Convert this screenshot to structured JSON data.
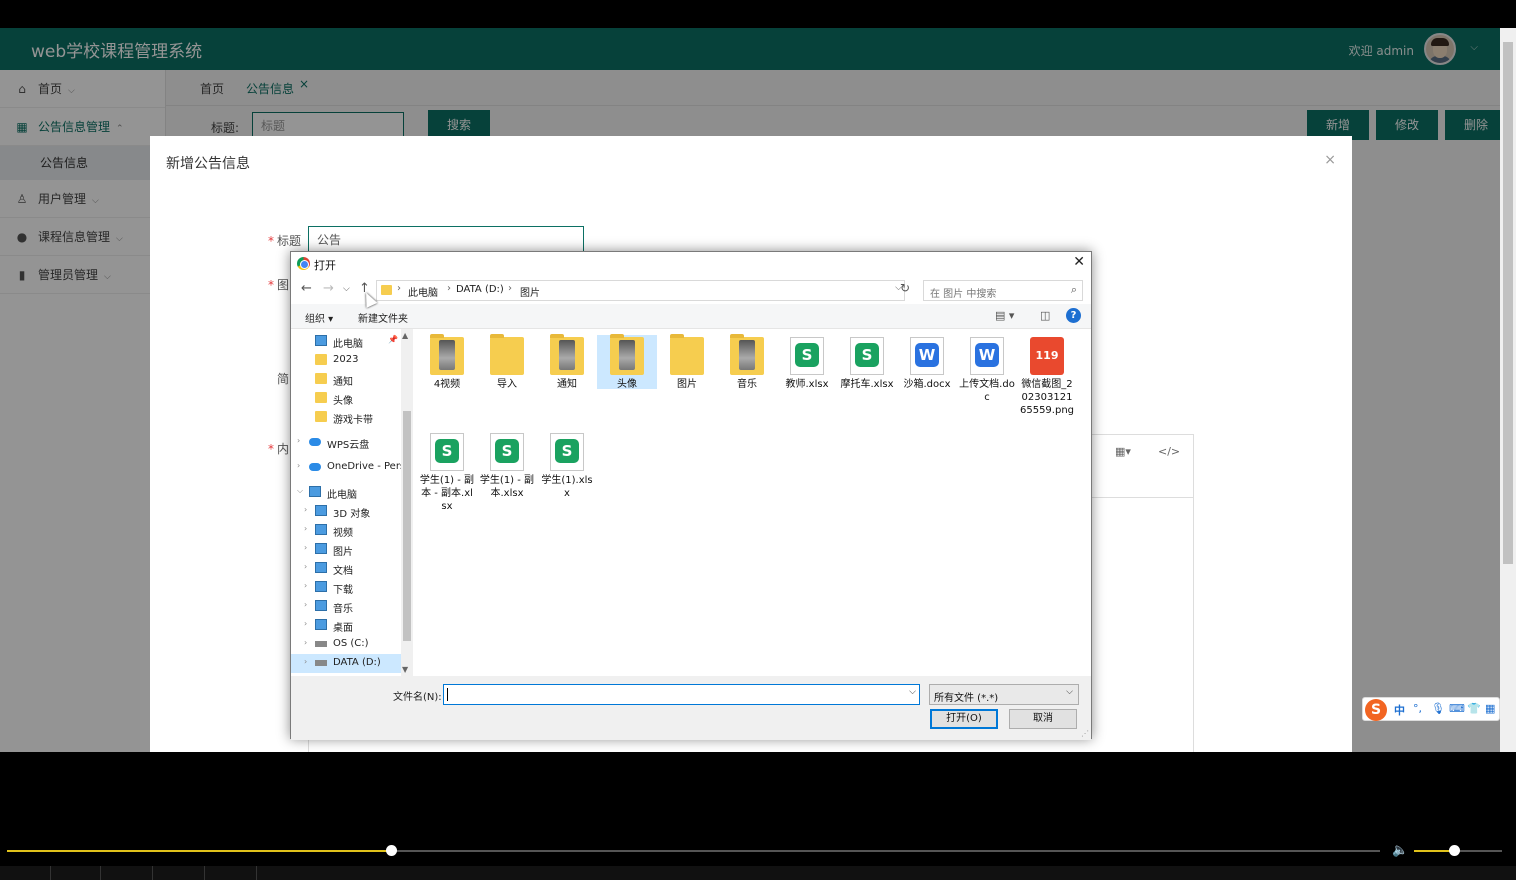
{
  "app": {
    "title": "web学校课程管理系统",
    "welcome": "欢迎 admin",
    "brand_color": "#0c7064"
  },
  "sidebar": {
    "items": [
      {
        "label": "首页",
        "icon": "home-icon"
      },
      {
        "label": "公告信息管理",
        "icon": "grid-icon"
      },
      {
        "label": "用户管理",
        "icon": "user-icon"
      },
      {
        "label": "课程信息管理",
        "icon": "book-icon"
      },
      {
        "label": "管理员管理",
        "icon": "admin-icon"
      }
    ],
    "sub_item": "公告信息"
  },
  "tabs": [
    {
      "label": "首页"
    },
    {
      "label": "公告信息"
    }
  ],
  "toolbar": {
    "search_label": "标题:",
    "search_placeholder": "标题",
    "search_button": "搜索",
    "add_button": "新增",
    "edit_button": "修改",
    "delete_button": "删除"
  },
  "modal": {
    "title": "新增公告信息",
    "close": "×",
    "fields": {
      "title_label": "标题",
      "title_value": "公告",
      "image_label": "图",
      "summary_label": "简",
      "content_label": "内"
    },
    "editor_table_icon": "▦▾",
    "editor_code_icon": "</>"
  },
  "dialog": {
    "title": "打开",
    "breadcrumb": [
      "此电脑",
      "DATA (D:)",
      "图片"
    ],
    "search_placeholder": "在 图片 中搜索",
    "commands": {
      "organize": "组织 ▾",
      "new_folder": "新建文件夹"
    },
    "tree": [
      {
        "label": "此电脑",
        "type": "pc",
        "pinned": true
      },
      {
        "label": "2023",
        "type": "folder"
      },
      {
        "label": "通知",
        "type": "folder"
      },
      {
        "label": "头像",
        "type": "folder"
      },
      {
        "label": "游戏卡带",
        "type": "folder"
      },
      {
        "label": "WPS云盘",
        "type": "cloud"
      },
      {
        "label": "OneDrive - Perso",
        "type": "cloud"
      },
      {
        "label": "此电脑",
        "type": "pc"
      },
      {
        "label": "3D 对象",
        "type": "pc"
      },
      {
        "label": "视频",
        "type": "pc"
      },
      {
        "label": "图片",
        "type": "pc"
      },
      {
        "label": "文档",
        "type": "pc"
      },
      {
        "label": "下载",
        "type": "pc"
      },
      {
        "label": "音乐",
        "type": "pc"
      },
      {
        "label": "桌面",
        "type": "pc"
      },
      {
        "label": "OS (C:)",
        "type": "drive"
      },
      {
        "label": "DATA (D:)",
        "type": "drive",
        "selected": true
      }
    ],
    "files": [
      {
        "name": "4视频",
        "type": "folder-photo"
      },
      {
        "name": "导入",
        "type": "folder"
      },
      {
        "name": "通知",
        "type": "folder-photo"
      },
      {
        "name": "头像",
        "type": "folder-photo",
        "selected": true
      },
      {
        "name": "图片",
        "type": "folder"
      },
      {
        "name": "音乐",
        "type": "folder-photo"
      },
      {
        "name": "教师.xlsx",
        "type": "sheet"
      },
      {
        "name": "摩托车.xlsx",
        "type": "sheet"
      },
      {
        "name": "沙箱.docx",
        "type": "word"
      },
      {
        "name": "上传文档.doc",
        "type": "word"
      },
      {
        "name": "微信截图_20230312165559.png",
        "type": "image",
        "thumb": "119"
      },
      {
        "name": "学生(1) - 副本 - 副本.xlsx",
        "type": "sheet"
      },
      {
        "name": "学生(1) - 副本.xlsx",
        "type": "sheet"
      },
      {
        "name": "学生(1).xlsx",
        "type": "sheet"
      }
    ],
    "filename_label": "文件名(N):",
    "filename_value": "",
    "filetype": "所有文件 (*.*)",
    "open_button": "打开(O)",
    "cancel_button": "取消"
  },
  "ime": {
    "logo": "S",
    "mode": "中"
  },
  "player": {
    "progress": 0.28,
    "volume": 0.45,
    "accent": "#e0c21b"
  }
}
